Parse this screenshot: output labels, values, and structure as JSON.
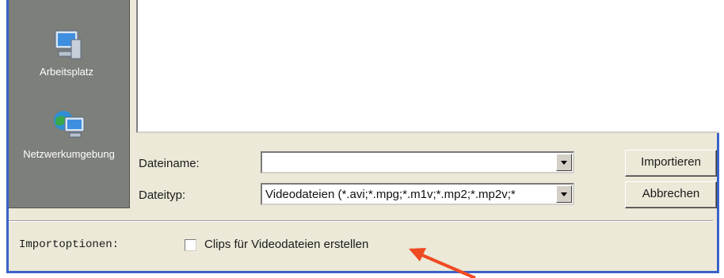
{
  "places": {
    "items": [
      {
        "label": "Arbeitsplatz",
        "icon": "computer-icon"
      },
      {
        "label": "Netzwerkumgebung",
        "icon": "network-computer-icon"
      }
    ]
  },
  "form": {
    "filename_label": "Dateiname:",
    "filename_value": "",
    "filetype_label": "Dateityp:",
    "filetype_value": "Videodateien (*.avi;*.mpg;*.m1v;*.mp2;*.mp2v;*"
  },
  "buttons": {
    "import": "Importieren",
    "cancel": "Abbrechen"
  },
  "options": {
    "label": "Importoptionen:",
    "clips_checkbox_label": "Clips für Videodateien erstellen",
    "clips_checked": false
  },
  "colors": {
    "frame_border": "#3a62c8",
    "annotation_arrow": "#f04a23"
  }
}
